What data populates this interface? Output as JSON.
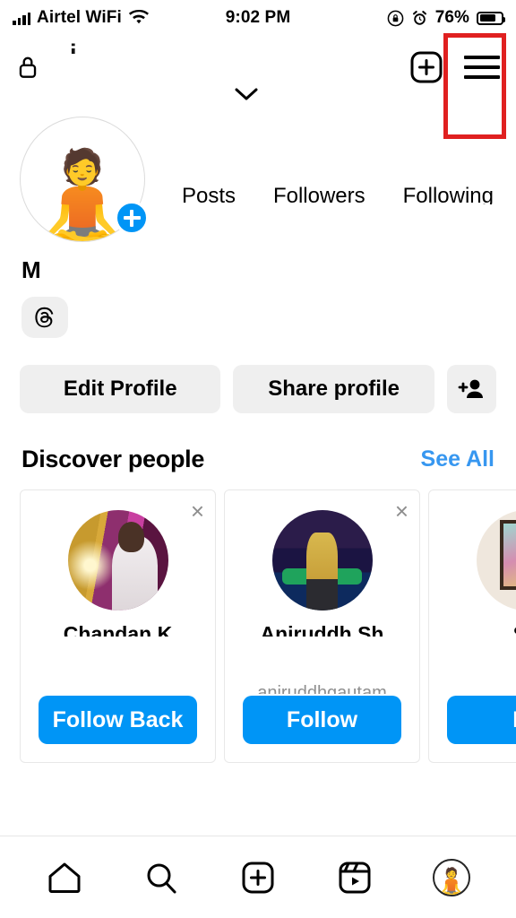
{
  "status_bar": {
    "carrier": "Airtel WiFi",
    "time": "9:02 PM",
    "battery_percent": "76%",
    "icons": [
      "signal-bars-icon",
      "wifi-icon",
      "rotation-lock-icon",
      "alarm-icon",
      "battery-icon"
    ]
  },
  "header": {
    "lock_icon": "lock-icon",
    "username": "i",
    "chevron": "chevron-down-icon",
    "new_post_icon": "plus-box-icon",
    "menu_icon": "hamburger-menu-icon"
  },
  "annotation": {
    "shape": "rectangle",
    "color": "#e02020",
    "target": "hamburger-menu-icon"
  },
  "profile": {
    "avatar_emoji": "🧘",
    "add_badge": "plus-badge",
    "display_name": "M",
    "threads_badge": "threads-icon",
    "stats": [
      {
        "label": "Posts",
        "value": ""
      },
      {
        "label": "Followers",
        "value": ""
      },
      {
        "label": "Following",
        "value": ""
      }
    ]
  },
  "actions": {
    "edit_profile": "Edit Profile",
    "share_profile": "Share profile",
    "add_person_icon": "add-person-icon"
  },
  "discover": {
    "title": "Discover people",
    "see_all": "See All",
    "cards": [
      {
        "name": "Chandan K",
        "username": "",
        "button": "Follow Back",
        "close": "×",
        "photo": "ph1"
      },
      {
        "name": "Aniruddh Sh",
        "username": "aniruddhgautam",
        "button": "Follow",
        "close": "×",
        "photo": "ph2"
      },
      {
        "name": "Sh",
        "username": "",
        "button": "Fo",
        "close": "×",
        "photo": "ph3"
      }
    ]
  },
  "tabbar": {
    "items": [
      {
        "icon": "home-icon",
        "label": "Home"
      },
      {
        "icon": "search-icon",
        "label": "Search"
      },
      {
        "icon": "plus-box-icon",
        "label": "Create"
      },
      {
        "icon": "reels-icon",
        "label": "Reels"
      },
      {
        "icon": "profile-avatar-icon",
        "label": "Profile"
      }
    ],
    "active": "profile-avatar-icon",
    "avatar_emoji": "🧘"
  },
  "colors": {
    "accent_blue": "#0095f6",
    "link_blue": "#3797f0",
    "button_gray": "#efefef",
    "annotation_red": "#e02020"
  }
}
